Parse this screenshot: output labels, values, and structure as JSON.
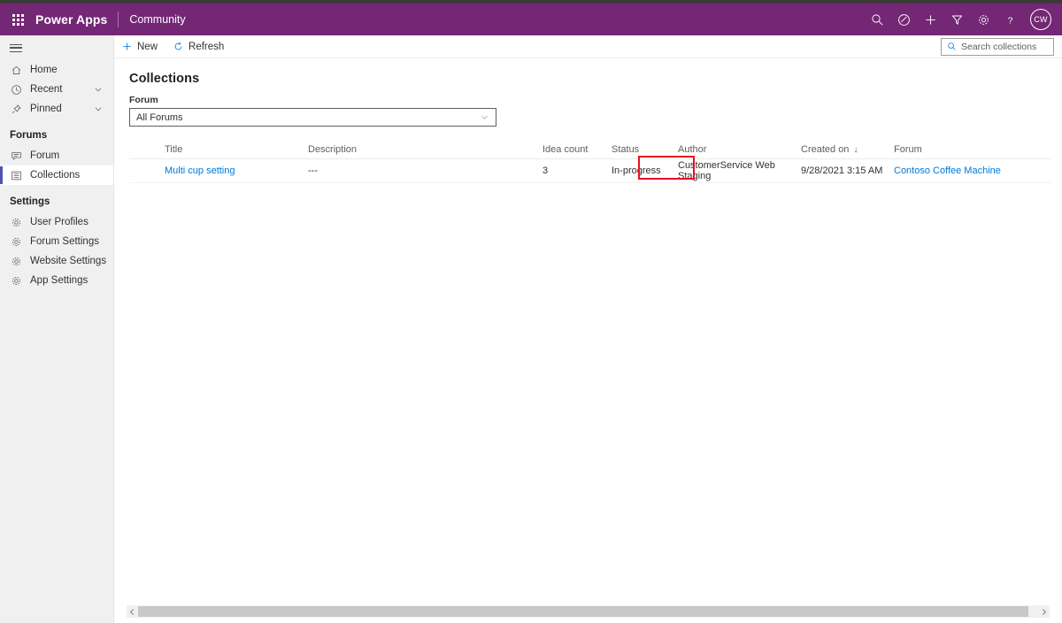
{
  "header": {
    "waffle_label": "app-launcher",
    "brand": "Power Apps",
    "sub_brand": "Community",
    "icons": [
      {
        "name": "search-icon",
        "label": "Search"
      },
      {
        "name": "diagnostics-icon",
        "label": "Diagnostics"
      },
      {
        "name": "plus-icon",
        "label": "New"
      },
      {
        "name": "filter-icon",
        "label": "Filter"
      },
      {
        "name": "gear-icon",
        "label": "Settings"
      },
      {
        "name": "help-icon",
        "label": "Help"
      }
    ],
    "avatar_initials": "CW",
    "brand_color": "#742774"
  },
  "sidebar": {
    "hamburger_label": "Site map",
    "items": [
      {
        "label": "Home",
        "icon": "home-icon",
        "expandable": false
      },
      {
        "label": "Recent",
        "icon": "clock-icon",
        "expandable": true
      },
      {
        "label": "Pinned",
        "icon": "pin-icon",
        "expandable": true
      }
    ],
    "groups": [
      {
        "title": "Forums",
        "items": [
          {
            "label": "Forum",
            "icon": "forum-icon",
            "active": false
          },
          {
            "label": "Collections",
            "icon": "collections-icon",
            "active": true
          }
        ]
      },
      {
        "title": "Settings",
        "items": [
          {
            "label": "User Profiles",
            "icon": "gear-icon",
            "active": false
          },
          {
            "label": "Forum Settings",
            "icon": "gear-icon",
            "active": false
          },
          {
            "label": "Website Settings",
            "icon": "gear-icon",
            "active": false
          },
          {
            "label": "App Settings",
            "icon": "gear-icon",
            "active": false
          }
        ]
      }
    ],
    "active_indicator_color": "#4f52b2"
  },
  "commandbar": {
    "new_label": "New",
    "refresh_label": "Refresh",
    "search_placeholder": "Search collections",
    "search_value": "",
    "accent_color": "#0078d4"
  },
  "main": {
    "page_title": "Collections",
    "filter_label": "Forum",
    "filter_value": "All Forums"
  },
  "grid": {
    "columns": [
      {
        "key": "title",
        "label": "Title"
      },
      {
        "key": "description",
        "label": "Description"
      },
      {
        "key": "idea_count",
        "label": "Idea count"
      },
      {
        "key": "status",
        "label": "Status"
      },
      {
        "key": "author",
        "label": "Author"
      },
      {
        "key": "created_on",
        "label": "Created on",
        "sorted": "descending",
        "sort_glyph": "↓"
      },
      {
        "key": "forum",
        "label": "Forum"
      }
    ],
    "rows": [
      {
        "title": "Multi cup setting",
        "description": "---",
        "idea_count": "3",
        "status": "In-progress",
        "author": "CustomerService Web Staging",
        "created_on": "9/28/2021 3:15 AM",
        "forum": "Contoso Coffee Machine"
      }
    ]
  },
  "annotation": {
    "name": "status-highlight-box",
    "color": "#e81123",
    "targets": "In-progress"
  },
  "scrollbar": {
    "left_arrow": "◀",
    "right_arrow": "▶",
    "orientation": "horizontal"
  }
}
